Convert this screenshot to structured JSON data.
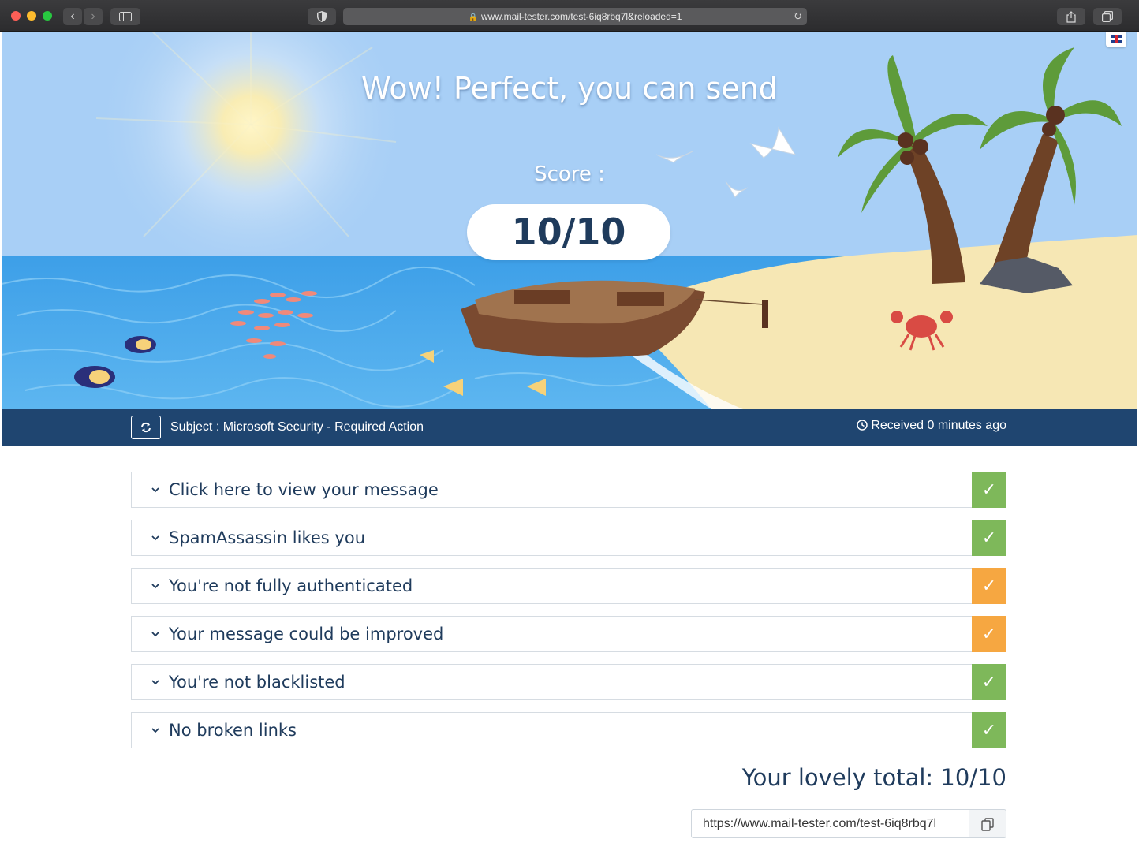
{
  "browser": {
    "url": "www.mail-tester.com/test-6iq8rbq7l&reloaded=1"
  },
  "hero": {
    "title": "Wow! Perfect, you can send",
    "score_label": "Score :",
    "score_value": "10/10",
    "language_flag": "uk-flag-icon"
  },
  "subject_bar": {
    "subject": "Subject : Microsoft Security - Required Action",
    "received": "Received 0 minutes ago"
  },
  "results": [
    {
      "label": "Click here to view your message",
      "status": "pass",
      "color": "#7eb85a",
      "icon": "check-icon"
    },
    {
      "label": "SpamAssassin likes you",
      "status": "pass",
      "color": "#7eb85a",
      "icon": "check-icon"
    },
    {
      "label": "You're not fully authenticated",
      "status": "warning",
      "color": "#f6a741",
      "icon": "check-icon"
    },
    {
      "label": "Your message could be improved",
      "status": "warning",
      "color": "#f6a741",
      "icon": "check-icon"
    },
    {
      "label": "You're not blacklisted",
      "status": "pass",
      "color": "#7eb85a",
      "icon": "check-icon"
    },
    {
      "label": "No broken links",
      "status": "pass",
      "color": "#7eb85a",
      "icon": "check-icon"
    }
  ],
  "total": "Your lovely total: 10/10",
  "share": {
    "url_value": "https://www.mail-tester.com/test-6iq8rbq7l"
  },
  "colors": {
    "navy": "#1f4570",
    "text": "#1f3b5c",
    "pass": "#7eb85a",
    "warning": "#f6a741"
  }
}
